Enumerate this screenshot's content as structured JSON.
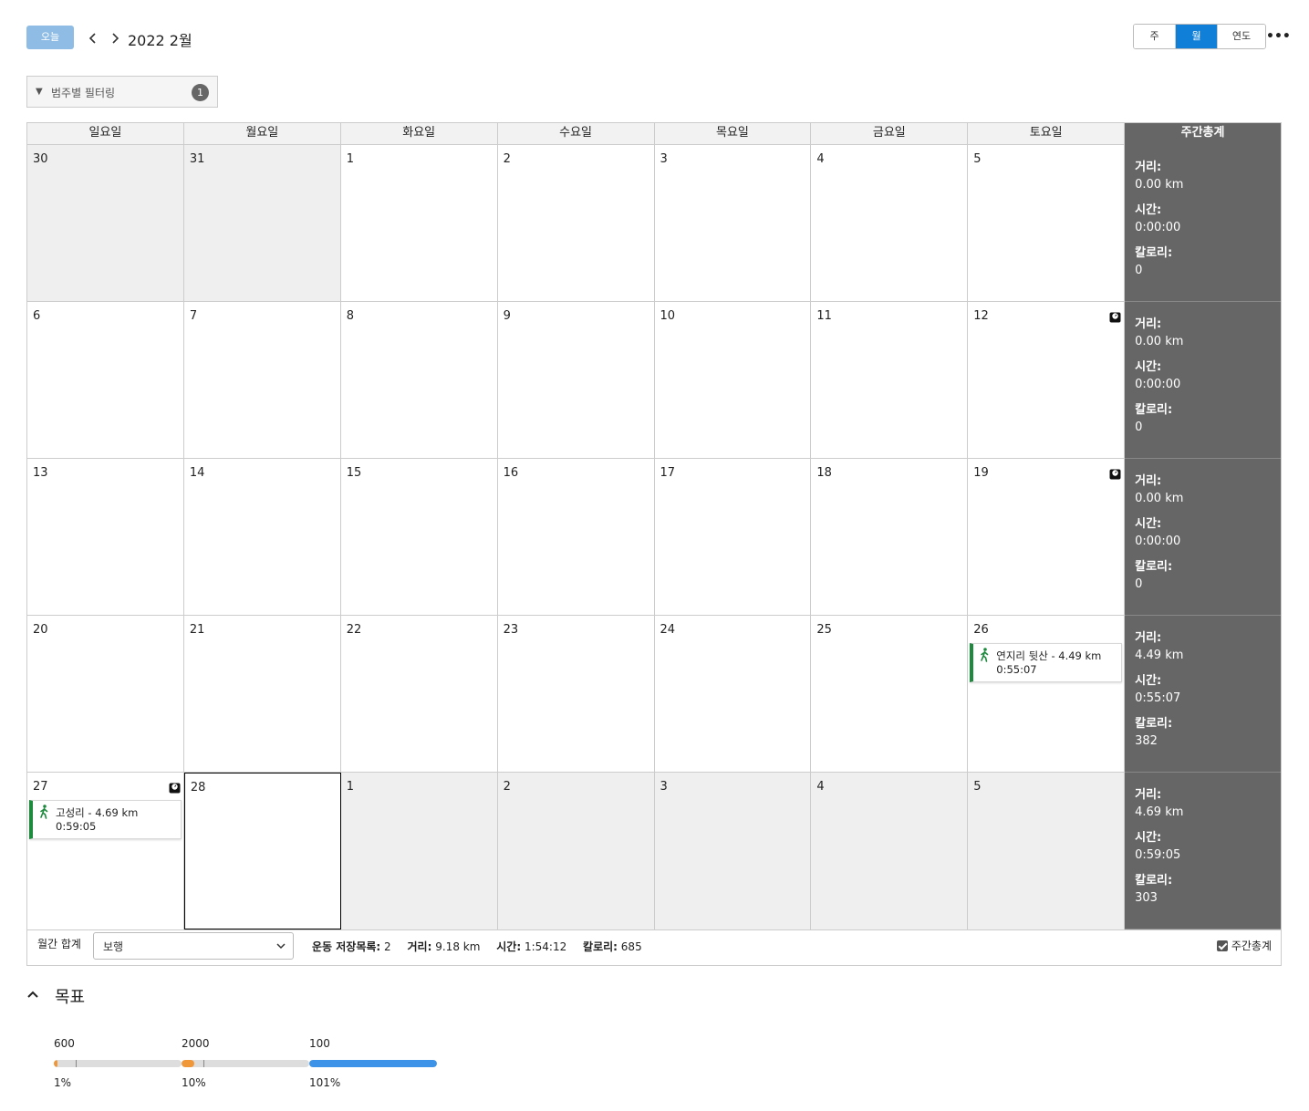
{
  "toolbar": {
    "today_label": "오늘",
    "period_title": "2022 2월",
    "view_options": [
      "주",
      "월",
      "연도"
    ],
    "active_view": "월",
    "more_label": "•••"
  },
  "filter": {
    "label": "범주별 필터링",
    "count": "1"
  },
  "weekdays": [
    "일요일",
    "월요일",
    "화요일",
    "수요일",
    "목요일",
    "금요일",
    "토요일"
  ],
  "summary_header": "주간총계",
  "weeks": [
    {
      "days": [
        {
          "num": "30",
          "other": true
        },
        {
          "num": "31",
          "other": true
        },
        {
          "num": "1"
        },
        {
          "num": "2"
        },
        {
          "num": "3"
        },
        {
          "num": "4"
        },
        {
          "num": "5"
        }
      ],
      "summary": {
        "distance_label": "거리:",
        "distance": "0.00 km",
        "time_label": "시간:",
        "time": "0:00:00",
        "calories_label": "칼로리:",
        "calories": "0"
      }
    },
    {
      "days": [
        {
          "num": "6"
        },
        {
          "num": "7"
        },
        {
          "num": "8"
        },
        {
          "num": "9"
        },
        {
          "num": "10"
        },
        {
          "num": "11"
        },
        {
          "num": "12",
          "weigh_in": true
        }
      ],
      "summary": {
        "distance_label": "거리:",
        "distance": "0.00 km",
        "time_label": "시간:",
        "time": "0:00:00",
        "calories_label": "칼로리:",
        "calories": "0"
      }
    },
    {
      "days": [
        {
          "num": "13"
        },
        {
          "num": "14"
        },
        {
          "num": "15"
        },
        {
          "num": "16"
        },
        {
          "num": "17"
        },
        {
          "num": "18"
        },
        {
          "num": "19",
          "weigh_in": true
        }
      ],
      "summary": {
        "distance_label": "거리:",
        "distance": "0.00 km",
        "time_label": "시간:",
        "time": "0:00:00",
        "calories_label": "칼로리:",
        "calories": "0"
      }
    },
    {
      "days": [
        {
          "num": "20"
        },
        {
          "num": "21"
        },
        {
          "num": "22"
        },
        {
          "num": "23"
        },
        {
          "num": "24"
        },
        {
          "num": "25"
        },
        {
          "num": "26",
          "activity": {
            "title": "연지리 뒷산 - 4.49 km",
            "time": "0:55:07"
          }
        }
      ],
      "summary": {
        "distance_label": "거리:",
        "distance": "4.49 km",
        "time_label": "시간:",
        "time": "0:55:07",
        "calories_label": "칼로리:",
        "calories": "382"
      }
    },
    {
      "days": [
        {
          "num": "27",
          "weigh_in": true,
          "activity": {
            "title": "고성리 - 4.69 km",
            "time": "0:59:05"
          }
        },
        {
          "num": "28",
          "today": true
        },
        {
          "num": "1",
          "other": true
        },
        {
          "num": "2",
          "other": true
        },
        {
          "num": "3",
          "other": true
        },
        {
          "num": "4",
          "other": true
        },
        {
          "num": "5",
          "other": true
        }
      ],
      "summary": {
        "distance_label": "거리:",
        "distance": "4.69 km",
        "time_label": "시간:",
        "time": "0:59:05",
        "calories_label": "칼로리:",
        "calories": "303"
      }
    }
  ],
  "monthly": {
    "label": "월간 합계",
    "select_value": "보행",
    "saved_label": "운동 저장목록:",
    "saved_value": "2",
    "distance_label": "거리:",
    "distance_value": "9.18 km",
    "time_label": "시간:",
    "time_value": "1:54:12",
    "calories_label": "칼로리:",
    "calories_value": "685",
    "weekly_totals_label": "주간총계"
  },
  "goals": {
    "title": "목표",
    "items": [
      {
        "target": "600",
        "percent": "1%",
        "progress": 0.01,
        "color": "#f0973a"
      },
      {
        "target": "2000",
        "percent": "10%",
        "progress": 0.1,
        "color": "#f0973a"
      },
      {
        "target": "100",
        "percent": "101%",
        "progress": 1.0,
        "color": "#3d93e8"
      }
    ]
  },
  "colors": {
    "accent": "#0f7fd8",
    "today_button": "#8ebce4",
    "activity_bar": "#1d8a3e",
    "summary_bg": "#666666"
  }
}
